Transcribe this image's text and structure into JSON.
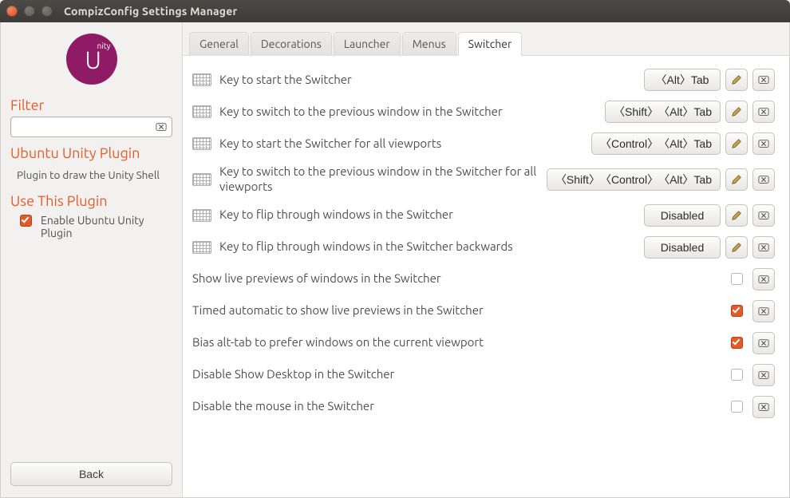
{
  "titlebar": {
    "title": "CompizConfig Settings Manager"
  },
  "sidebar": {
    "filter_heading": "Filter",
    "filter_value": "",
    "plugin_heading": "Ubuntu Unity Plugin",
    "plugin_desc": "Plugin to draw the Unity Shell",
    "use_heading": "Use This Plugin",
    "enable_label": "Enable Ubuntu Unity Plugin",
    "enable_checked": true,
    "back_label": "Back"
  },
  "tabs": [
    {
      "id": "general",
      "label": "General",
      "active": false
    },
    {
      "id": "decorations",
      "label": "Decorations",
      "active": false
    },
    {
      "id": "launcher",
      "label": "Launcher",
      "active": false
    },
    {
      "id": "menus",
      "label": "Menus",
      "active": false
    },
    {
      "id": "switcher",
      "label": "Switcher",
      "active": true
    }
  ],
  "settings": {
    "key_rows": [
      {
        "label": "Key to start the Switcher",
        "binding": "〈Alt〉Tab"
      },
      {
        "label": "Key to switch to the previous window in the Switcher",
        "binding": "〈Shift〉〈Alt〉Tab"
      },
      {
        "label": "Key to start the Switcher for all viewports",
        "binding": "〈Control〉〈Alt〉Tab"
      },
      {
        "label": "Key to switch to the previous window in the Switcher for all viewports",
        "binding": "〈Shift〉〈Control〉〈Alt〉Tab"
      },
      {
        "label": "Key to flip through windows in the Switcher",
        "binding": "Disabled"
      },
      {
        "label": "Key to flip through windows in the Switcher backwards",
        "binding": "Disabled"
      }
    ],
    "bool_rows": [
      {
        "label": "Show live previews of windows in the Switcher",
        "checked": false
      },
      {
        "label": "Timed automatic to show live previews in the Switcher",
        "checked": true
      },
      {
        "label": "Bias alt-tab to prefer windows on the current viewport",
        "checked": true
      },
      {
        "label": "Disable Show Desktop in the Switcher",
        "checked": false
      },
      {
        "label": "Disable the mouse in the Switcher",
        "checked": false
      }
    ]
  }
}
